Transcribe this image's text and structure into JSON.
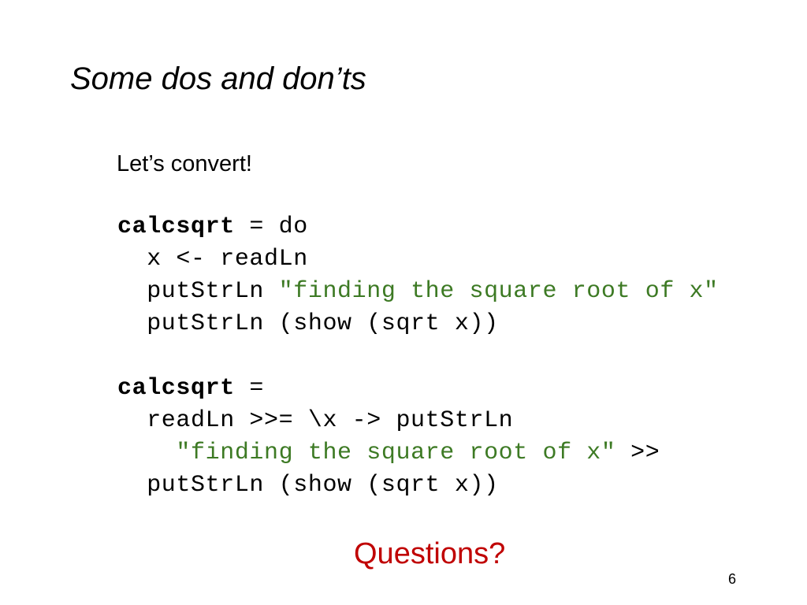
{
  "slide": {
    "title": "Some dos and don’ts",
    "subtitle": "Let’s convert!",
    "code_block_1": {
      "line1_name": "calcsqrt",
      "line1_rest": " = do",
      "line2": "  x <- readLn",
      "line3_prefix": "  putStrLn ",
      "line3_string": "\"finding the square root of x\"",
      "line4": "  putStrLn (show (sqrt x))"
    },
    "code_block_2": {
      "line1_name": "calcsqrt",
      "line1_rest": " =",
      "line2": "  readLn >>= \\x -> putStrLn",
      "line3_prefix": "    ",
      "line3_string": "\"finding the square root of x\"",
      "line3_suffix": " >>",
      "line4": "  putStrLn (show (sqrt x))"
    },
    "questions": "Questions?",
    "page_number": "6"
  },
  "colors": {
    "string_literal": "#3d7a24",
    "questions": "#c00000",
    "text": "#000000",
    "background": "#ffffff"
  }
}
